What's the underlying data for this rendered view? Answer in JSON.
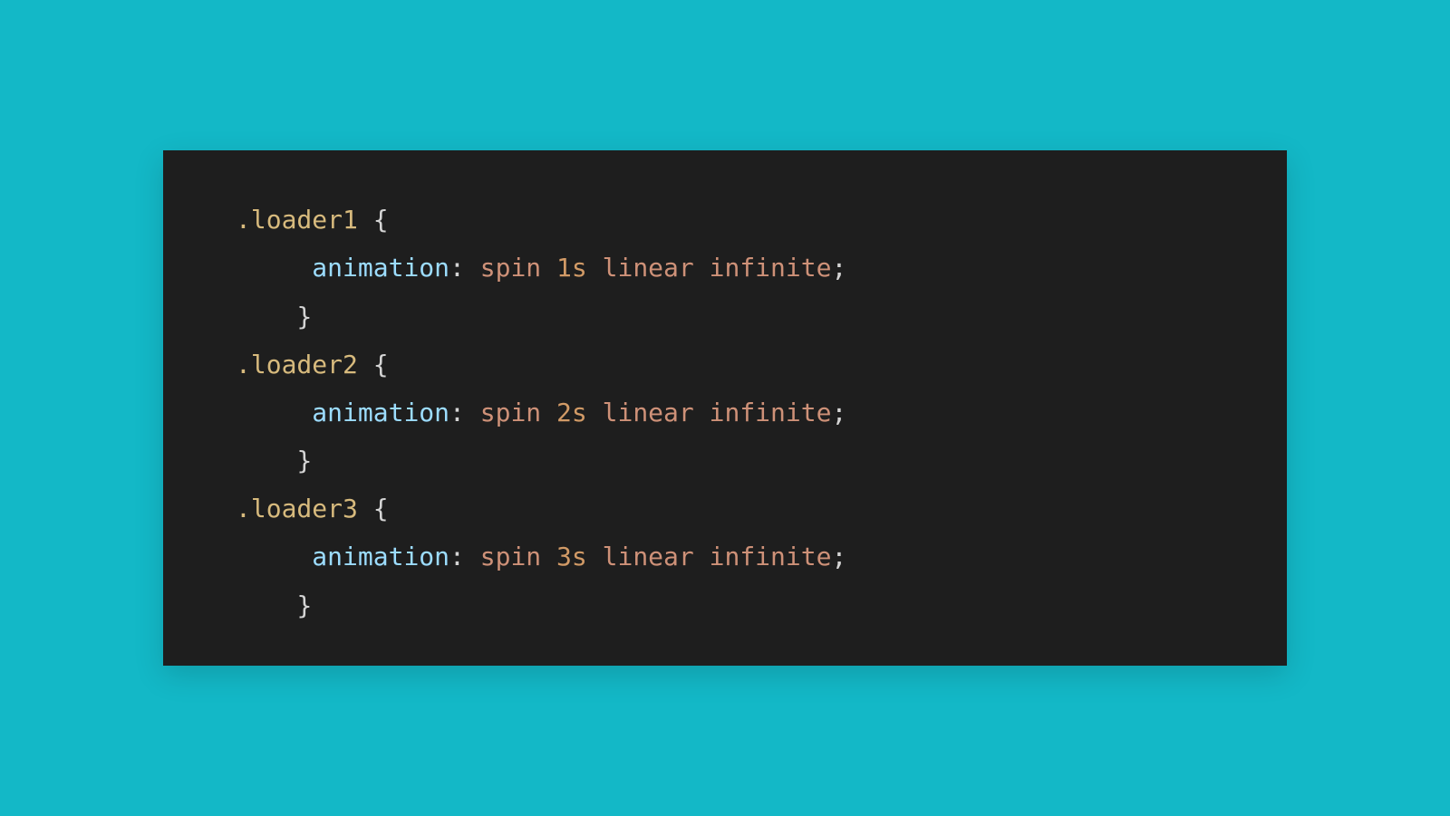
{
  "code": {
    "rules": [
      {
        "selector": ".loader1",
        "property": "animation",
        "duration": "1s",
        "rest": "spin",
        "tail": "linear infinite"
      },
      {
        "selector": ".loader2",
        "property": "animation",
        "duration": "2s",
        "rest": "spin",
        "tail": "linear infinite"
      },
      {
        "selector": ".loader3",
        "property": "animation",
        "duration": "3s",
        "rest": "spin",
        "tail": "linear infinite"
      }
    ]
  }
}
